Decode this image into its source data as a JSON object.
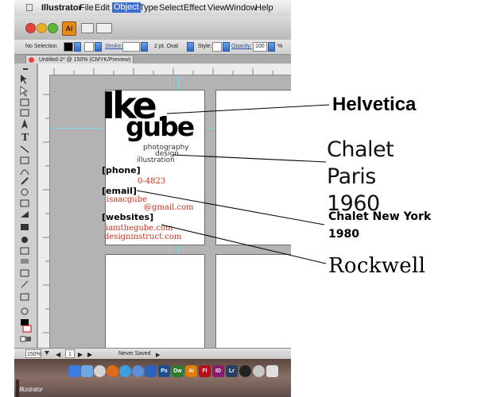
{
  "menubar": {
    "app_name": "Illustrator",
    "items": [
      "File",
      "Edit",
      "Object",
      "Type",
      "Select",
      "Effect",
      "View",
      "Window",
      "Help"
    ]
  },
  "titlebar": {
    "app_badge": "Ai"
  },
  "control_bar": {
    "selection": "No Selection",
    "stroke_label": "Stroke:",
    "brush_value": "2 pt. Oval",
    "style_label": "Style:",
    "opacity_label": "Opacity:",
    "opacity_value": "100",
    "percent": "%"
  },
  "document_tab": {
    "title": "Untitled-2* @ 150% (CMYK/Preview)"
  },
  "status_bar": {
    "zoom": "150%",
    "page": "1",
    "save_state": "Never Saved"
  },
  "dock": {
    "apps": [
      "Ps",
      "Dw",
      "Ai",
      "Fl",
      "ID",
      "Lr"
    ],
    "app_colors": [
      "#1e4d8c",
      "#2f7a2f",
      "#e07b00",
      "#b0121b",
      "#8a1a6e",
      "#2a3f5e"
    ],
    "bottom_label": "Illustrator"
  },
  "card": {
    "name_top": "Ike",
    "name_bottom": "gube",
    "roles": [
      "photography",
      "design",
      "illustration"
    ],
    "phone_heading": "[phone]",
    "phone_value": "0-4823",
    "email_heading": "[email]",
    "email_lines": [
      "isaacgube",
      "@gmail.com"
    ],
    "websites_heading": "[websites]",
    "website_lines": [
      "iamthegube.com",
      "designinstruct.com"
    ]
  },
  "annotations": {
    "helvetica": "Helvetica",
    "chalet_paris": "Chalet Paris 1960",
    "chalet_new_york": "Chalet New York 1980",
    "rockwell": "Rockwell"
  },
  "colors": {
    "accent_red": "#c9331f",
    "guide_cyan": "#7ed6f0",
    "selection_blue": "#2f6bc8"
  }
}
